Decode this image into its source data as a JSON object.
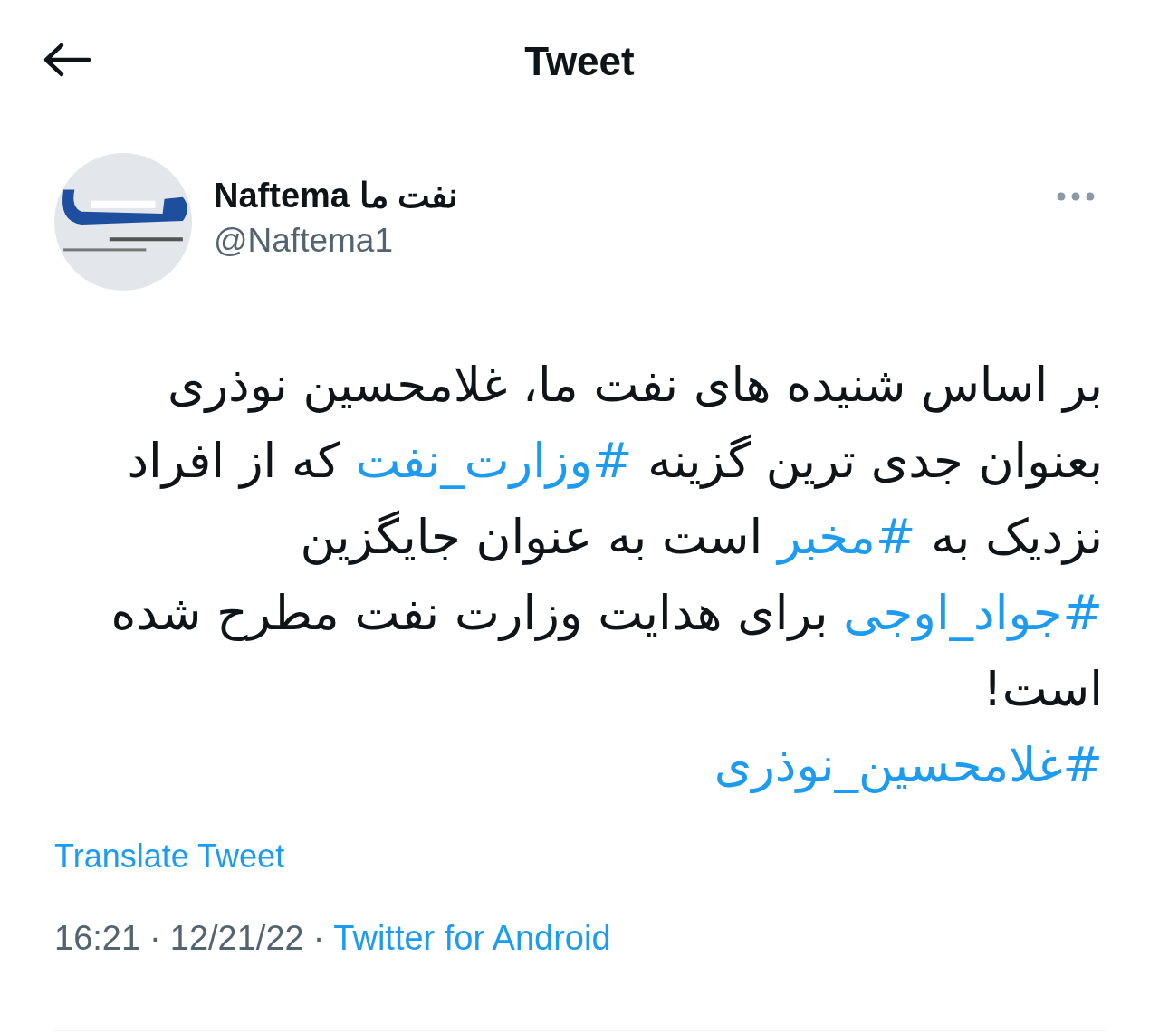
{
  "header": {
    "title": "Tweet"
  },
  "author": {
    "name": "Naftema نفت ما",
    "handle": "@Naftema1"
  },
  "body_lines": [
    [
      {
        "kind": "text",
        "text": "بر اساس شنیده های نفت ما، غلامحسین نوذری"
      }
    ],
    [
      {
        "kind": "text",
        "text": "بعنوان جدی ترین گزینه "
      },
      {
        "kind": "hashtag",
        "text": "#وزارت_نفت"
      },
      {
        "kind": "text",
        "text": " که از افراد"
      }
    ],
    [
      {
        "kind": "text",
        "text": "نزدیک به "
      },
      {
        "kind": "hashtag",
        "text": "#مخبر"
      },
      {
        "kind": "text",
        "text": " است به عنوان جایگزین"
      }
    ],
    [
      {
        "kind": "hashtag",
        "text": "#جواد_اوجی"
      },
      {
        "kind": "text",
        "text": " برای هدایت وزارت نفت مطرح شده"
      }
    ],
    [
      {
        "kind": "text",
        "text": "است!"
      }
    ],
    [
      {
        "kind": "hashtag",
        "text": "#غلامحسین_نوذری"
      }
    ]
  ],
  "translate_link": "Translate Tweet",
  "meta": {
    "time": "16:21",
    "separator": "·",
    "date": "12/21/22",
    "source": "Twitter for Android"
  }
}
